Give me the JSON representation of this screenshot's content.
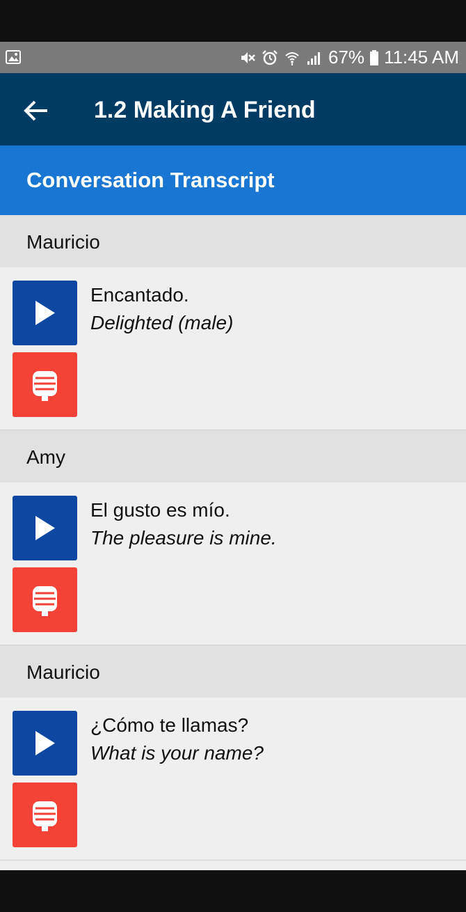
{
  "status_bar": {
    "battery": "67%",
    "time": "11:45 AM",
    "icons": [
      "gallery-icon",
      "mute-icon",
      "alarm-icon",
      "wifi-icon",
      "signal-icon",
      "battery-icon"
    ]
  },
  "app_bar": {
    "title": "1.2 Making A Friend",
    "back_icon": "arrow-back-icon"
  },
  "section": {
    "title": "Conversation Transcript"
  },
  "colors": {
    "app_bar": "#003b63",
    "section_header": "#1976d2",
    "play_button": "#0d47a1",
    "record_button": "#f44336"
  },
  "transcript": [
    {
      "speaker": "Mauricio",
      "phrase": "Encantado.",
      "translation": "Delighted (male)"
    },
    {
      "speaker": "Amy",
      "phrase": "El gusto es mío.",
      "translation": "The pleasure is mine."
    },
    {
      "speaker": "Mauricio",
      "phrase": "¿Cómo te llamas?",
      "translation": "What is your name?"
    }
  ]
}
